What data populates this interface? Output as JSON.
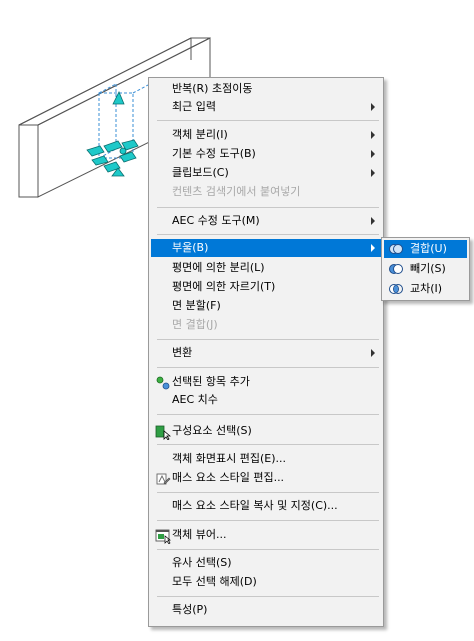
{
  "menu": {
    "repeat": "반복(R) 초점이동",
    "recent_input": "최근 입력",
    "explode": "객체 분리(I)",
    "basic_modify": "기본 수정 도구(B)",
    "clipboard": "클립보드(C)",
    "paste_from_content": "컨텐츠 검색기에서 붙여넣기",
    "aec_modify": "AEC 수정 도구(M)",
    "boolean": "부울(B)",
    "split_by_plane": "평면에 의한 분리(L)",
    "trim_by_plane": "평면에 의한 자르기(T)",
    "split_face": "면 분할(F)",
    "join_face": "면 결합(J)",
    "convert": "변환",
    "add_selected": "선택된 항목 추가",
    "aec_dimension": "AEC 치수",
    "select_component": "구성요소 선택(S)",
    "edit_display": "객체 화면표시 편집(E)...",
    "edit_mass_style": "매스 요소 스타일 편집...",
    "copy_assign_style": "매스 요소 스타일 복사 및 지정(C)...",
    "object_viewer": "객체 뷰어...",
    "select_similar": "유사 선택(S)",
    "deselect_all": "모두 선택 해제(D)",
    "properties": "특성(P)"
  },
  "submenu": {
    "union": "결합(U)",
    "subtract": "빼기(S)",
    "intersect": "교차(I)"
  },
  "icons": {
    "add_selected": "add-selected-icon",
    "select_component": "select-component-icon",
    "edit_mass_style": "mass-style-icon",
    "object_viewer": "object-viewer-icon",
    "union": "union-icon",
    "subtract": "subtract-icon",
    "intersect": "intersect-icon"
  },
  "colors": {
    "highlight": "#0078d7",
    "menu_bg": "#f2f2f2",
    "disabled_text": "#a8a8a8",
    "grip": "#1ec9c9"
  }
}
